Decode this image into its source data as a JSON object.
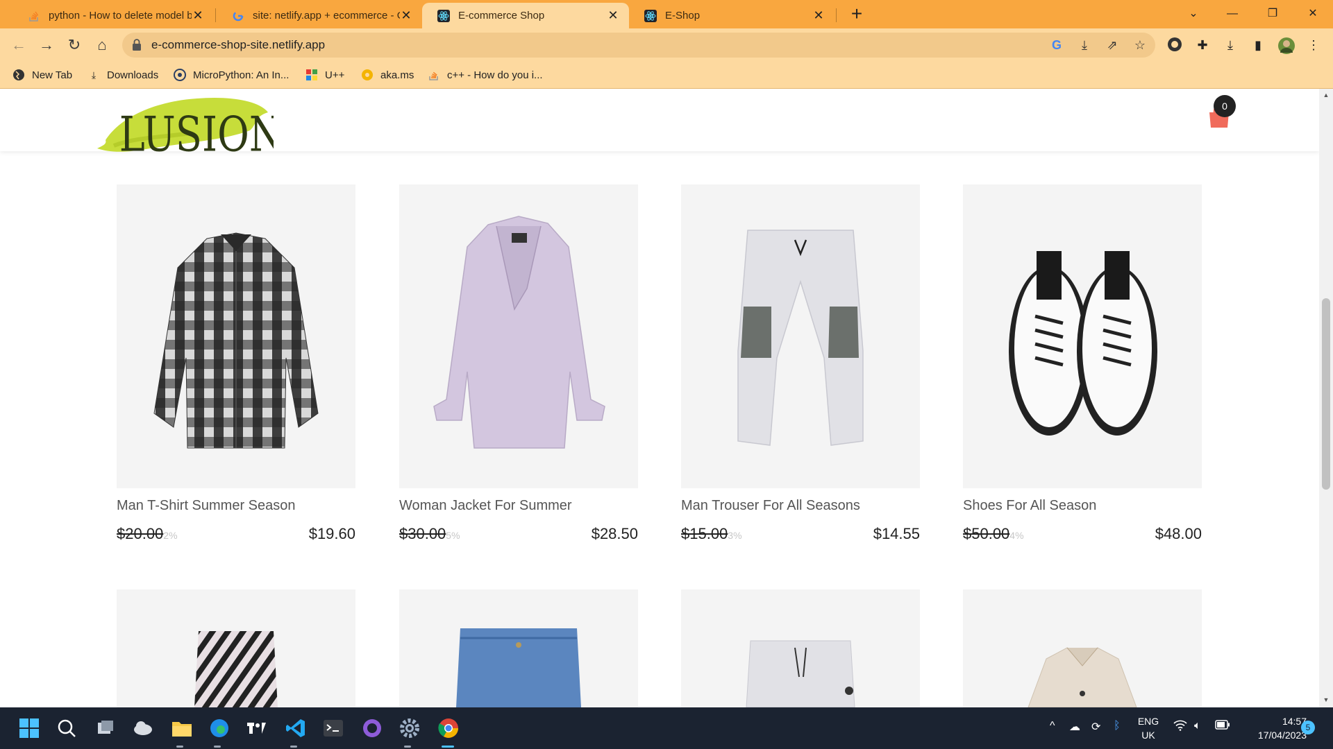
{
  "browser": {
    "tabs": [
      {
        "title": "python - How to delete model b",
        "icon": "stackoverflow-icon",
        "active": false
      },
      {
        "title": "site: netlify.app + ecommerce - G",
        "icon": "google-icon",
        "active": false
      },
      {
        "title": "E-commerce Shop",
        "icon": "react-icon",
        "active": true
      },
      {
        "title": "E-Shop",
        "icon": "react-icon",
        "active": false
      }
    ],
    "url": "e-commerce-shop-site.netlify.app",
    "bookmarks": [
      {
        "label": "New Tab",
        "icon": "globe-icon"
      },
      {
        "label": "Downloads",
        "icon": "download-icon"
      },
      {
        "label": "MicroPython: An In...",
        "icon": "micropython-icon"
      },
      {
        "label": "U++",
        "icon": "upp-icon"
      },
      {
        "label": "aka.ms",
        "icon": "akams-icon"
      },
      {
        "label": "c++ - How do you i...",
        "icon": "stackoverflow-icon"
      }
    ]
  },
  "site": {
    "logo_text": "LUSION",
    "cart_count": "0",
    "brand_color": "#f06b5b"
  },
  "products": [
    {
      "name": "Man T-Shirt Summer Season",
      "old_price": "$20.00",
      "discount": "2%",
      "price": "$19.60"
    },
    {
      "name": "Woman Jacket For Summer",
      "old_price": "$30.00",
      "discount": "5%",
      "price": "$28.50"
    },
    {
      "name": "Man Trouser For All Seasons",
      "old_price": "$15.00",
      "discount": "3%",
      "price": "$14.55"
    },
    {
      "name": "Shoes For All Season",
      "old_price": "$50.00",
      "discount": "4%",
      "price": "$48.00"
    }
  ],
  "taskbar": {
    "language": "ENG",
    "region": "UK",
    "time": "14:57",
    "date": "17/04/2023",
    "notifications": "5"
  }
}
